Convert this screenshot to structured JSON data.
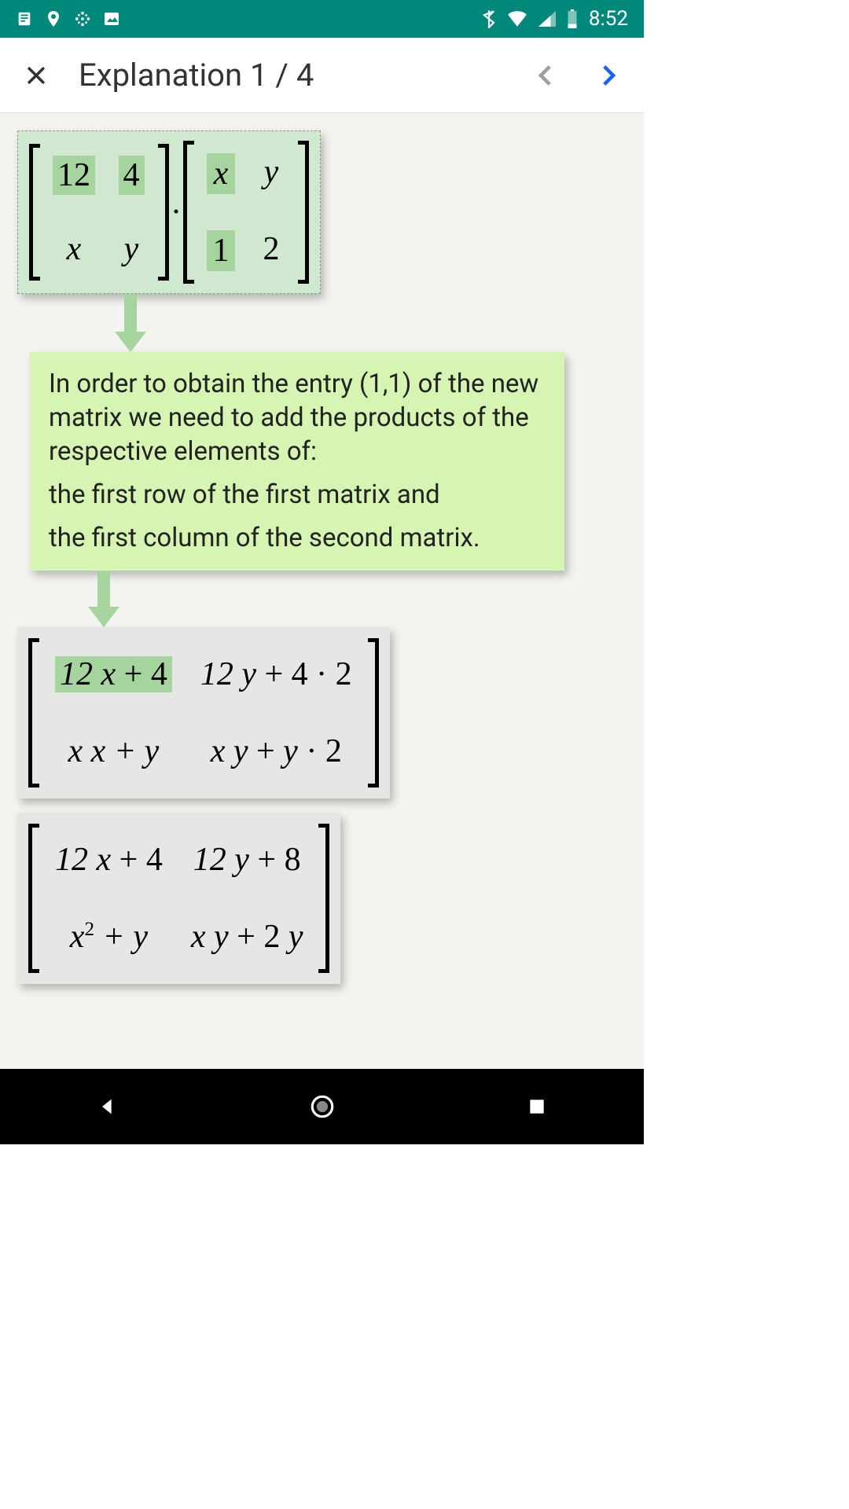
{
  "status": {
    "time": "8:52"
  },
  "appbar": {
    "title": "Explanation 1 / 4"
  },
  "matrix_a": {
    "r1c1": "12",
    "r1c2": "4",
    "r2c1": "x",
    "r2c2": "y"
  },
  "matrix_b": {
    "r1c1": "x",
    "r1c2": "y",
    "r2c1": "1",
    "r2c2": "2"
  },
  "explain": {
    "p1": "In order to obtain the entry (1,1) of the new matrix we need to add the products of the respective elements of:",
    "p2": "the first row of the first matrix and",
    "p3": "the first column of the second matrix."
  },
  "result1": {
    "r1c1": "12 x + 4",
    "r1c2": "12 y + 4 · 2",
    "r2c1": "x x + y",
    "r2c2": "x y + y · 2"
  },
  "result2": {
    "r1c1": "12 x + 4",
    "r1c2": "12 y + 8",
    "r2c1_a": "x",
    "r2c1_b": " + y",
    "r2c2": "x y + 2 y"
  }
}
